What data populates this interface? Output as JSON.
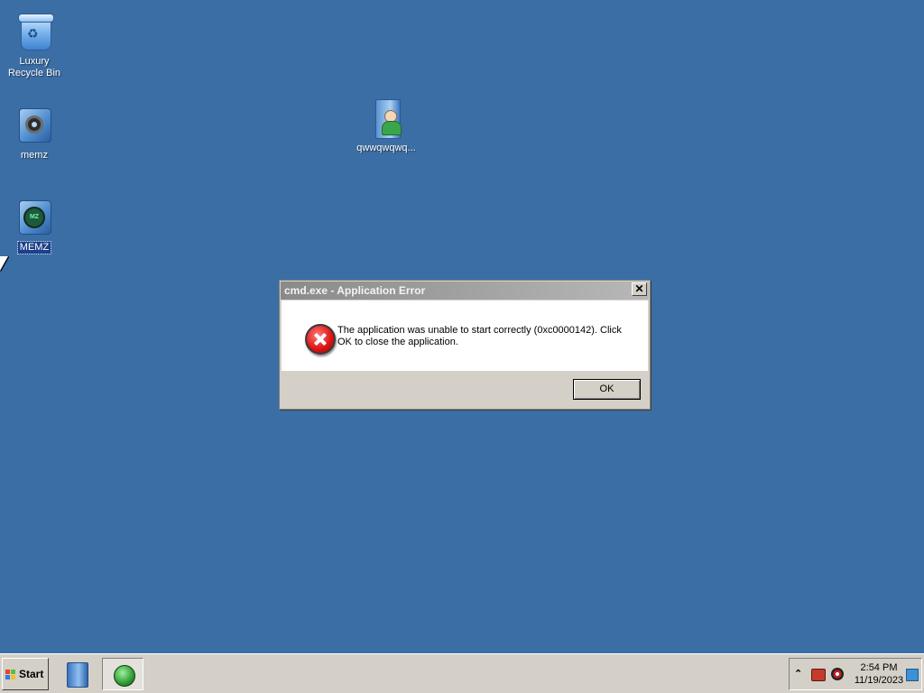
{
  "desktop": {
    "icons": [
      {
        "label": "Luxury Recycle Bin",
        "icon": "recycle-bin-icon"
      },
      {
        "label": "memz",
        "icon": "gear-app-icon"
      },
      {
        "label": "MEMZ",
        "icon": "memz-app-icon"
      },
      {
        "label": "qwwqwqwq...",
        "icon": "user-document-icon"
      }
    ]
  },
  "dialog": {
    "title": "cmd.exe - Application Error",
    "close_symbol": "✕",
    "icon": "error-icon",
    "message": "The application was unable to start correctly (0xc0000142). Click OK to close the application.",
    "ok_label": "OK"
  },
  "taskbar": {
    "start_label": "Start",
    "tray": {
      "expand_symbol": "⌃",
      "time": "2:54 PM",
      "date": "11/19/2023"
    }
  },
  "colors": {
    "desktop_bg": "#3a6ea5",
    "taskbar_bg": "#d4d0c8"
  }
}
